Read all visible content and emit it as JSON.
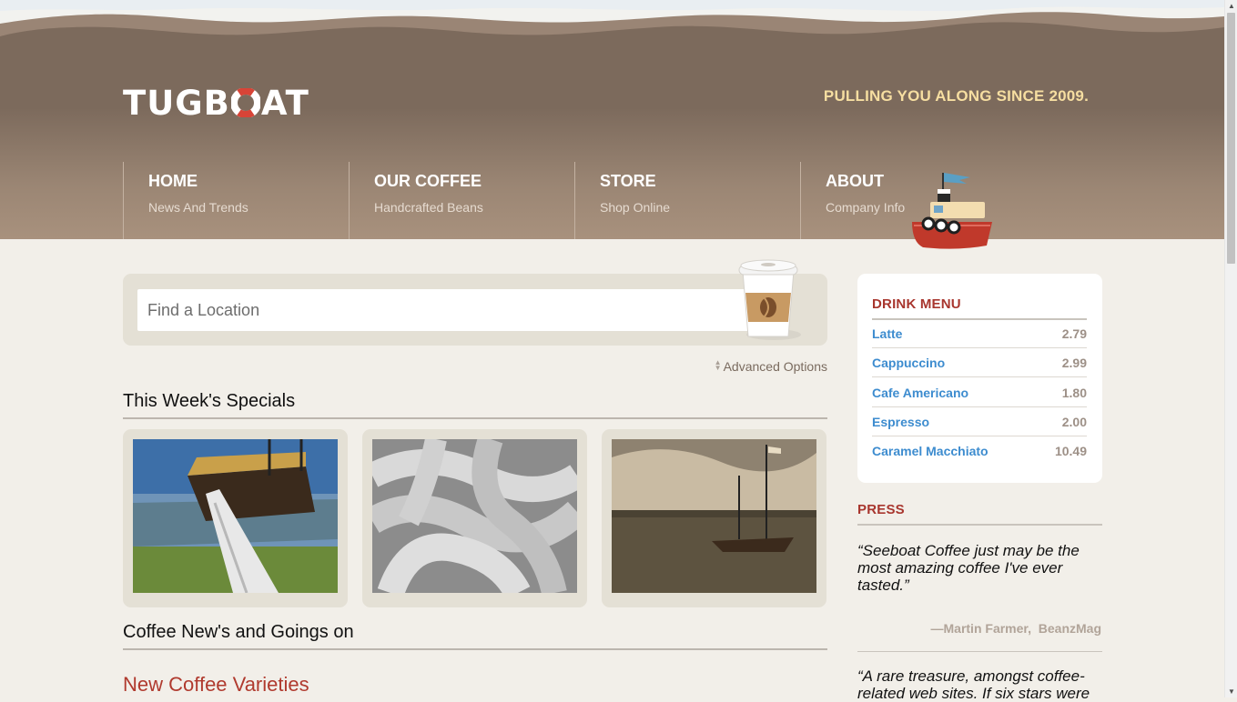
{
  "brand": {
    "logo_text_1": "TUGB",
    "logo_text_2": "AT",
    "tagline": "PULLING YOU ALONG SINCE 2009."
  },
  "nav": [
    {
      "title": "HOME",
      "subtitle": "News And Trends"
    },
    {
      "title": "OUR COFFEE",
      "subtitle": "Handcrafted Beans"
    },
    {
      "title": "STORE",
      "subtitle": "Shop Online"
    },
    {
      "title": "ABOUT",
      "subtitle": "Company Info"
    }
  ],
  "search": {
    "placeholder": "Find a Location",
    "advanced_label": "Advanced Options"
  },
  "specials": {
    "title": "This Week's Specials",
    "images": [
      "tall-ship-rope-photo",
      "coiled-rope-photo",
      "sailboat-sunset-photo"
    ]
  },
  "news": {
    "title": "Coffee New's and Goings on",
    "first_item": "New Coffee Varieties"
  },
  "drink_menu": {
    "title": "DRINK MENU",
    "items": [
      {
        "name": "Latte",
        "price": "2.79"
      },
      {
        "name": "Cappuccino",
        "price": "2.99"
      },
      {
        "name": "Cafe Americano",
        "price": "1.80"
      },
      {
        "name": "Espresso",
        "price": "2.00"
      },
      {
        "name": "Caramel Macchiato",
        "price": "10.49"
      }
    ]
  },
  "press": {
    "title": "PRESS",
    "quotes": [
      {
        "text": "“Seeboat Coffee just may be the most amazing coffee I've ever tasted.”",
        "author": "—Martin Farmer",
        "source": "BeanzMag"
      },
      {
        "text": "“A rare treasure, amongst coffee-related web sites. If six stars were"
      }
    ]
  },
  "colors": {
    "header_brown": "#7c6a5c",
    "accent_red": "#a8362e",
    "link_blue": "#3d8ccf",
    "tagline_yellow": "#f6dea1"
  }
}
